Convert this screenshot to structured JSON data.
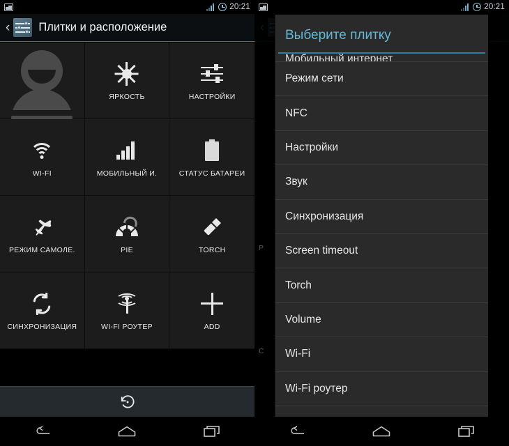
{
  "status_bar": {
    "notification_icon": "photo-icon",
    "signal_icon": "signal-bars-icon",
    "alarm_icon": "clock-icon",
    "time": "20:21"
  },
  "left_screen": {
    "action_bar": {
      "back_glyph": "‹",
      "app_icon": "sliders-icon",
      "title": "Плитки и расположение"
    },
    "tiles": [
      {
        "label": "",
        "icon": "user-avatar-icon"
      },
      {
        "label": "ЯРКОСТЬ",
        "icon": "brightness-sun-icon"
      },
      {
        "label": "НАСТРОЙКИ",
        "icon": "settings-sliders-icon"
      },
      {
        "label": "WI-FI",
        "icon": "wifi-icon"
      },
      {
        "label": "МОБИЛЬНЫЙ И.",
        "icon": "mobile-data-bars-icon"
      },
      {
        "label": "СТАТУС БАТАРЕИ",
        "icon": "battery-icon"
      },
      {
        "label": "РЕЖИМ САМОЛЕ.",
        "icon": "airplane-icon"
      },
      {
        "label": "PIE",
        "icon": "pie-control-icon"
      },
      {
        "label": "TORCH",
        "icon": "flashlight-icon"
      },
      {
        "label": "СИНХРОНИЗАЦИЯ",
        "icon": "sync-icon"
      },
      {
        "label": "WI-FI РОУТЕР",
        "icon": "hotspot-icon"
      },
      {
        "label": "ADD",
        "icon": "plus-icon"
      }
    ],
    "bottom_bar": {
      "reset_icon": "restore-reset-icon"
    }
  },
  "right_screen": {
    "dialog": {
      "title": "Выберите плитку",
      "clipped_top_item": "Мобильный интернет",
      "items": [
        "Режим сети",
        "NFC",
        "Настройки",
        "Звук",
        "Синхронизация",
        "Screen timeout",
        "Torch",
        "Volume",
        "Wi-Fi",
        "Wi-Fi роутер"
      ]
    },
    "background_ghost_labels": [
      "Р",
      "Р",
      "С"
    ]
  },
  "nav_bar": {
    "back": "back-icon",
    "home": "home-icon",
    "recents": "recents-icon"
  },
  "colors": {
    "accent_blue": "#2f7fa0",
    "title_blue": "#62b8d8",
    "dialog_bg": "#2a2a2a",
    "tile_bg": "#1c1c1c",
    "bottom_strip": "#242a2e"
  }
}
